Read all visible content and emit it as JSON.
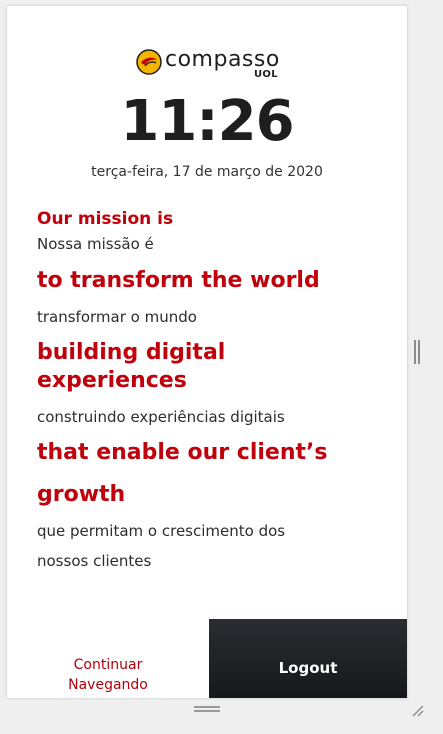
{
  "logo": {
    "wordmark": "compasso",
    "sub": "UOL"
  },
  "clock": {
    "time": "11:26",
    "date": "terça-feira, 17 de março de 2020"
  },
  "mission": {
    "heading_en": "Our mission is",
    "heading_pt": "Nossa missão é",
    "line1_en": "to transform the world",
    "line1_pt": "transformar o mundo",
    "line2_en": "building digital experiences",
    "line2_pt": "construindo experiências digitais",
    "line3_en_a": "that enable our client’s",
    "line3_en_b": "growth",
    "line3_pt_a": "que permitam o crescimento dos",
    "line3_pt_b": "nossos clientes"
  },
  "footer": {
    "continue_line1": "Continuar",
    "continue_line2": "Navegando",
    "logout_label": "Logout"
  },
  "colors": {
    "accent_red": "#c0000b",
    "logout_bg": "#1e2023",
    "logo_yellow": "#f5b400"
  },
  "icons": {
    "logo_mark": "compasso-logo-icon",
    "resize_vertical": "vertical-resize-handle-icon",
    "resize_horizontal": "horizontal-resize-handle-icon",
    "resize_corner": "resize-corner-icon"
  }
}
